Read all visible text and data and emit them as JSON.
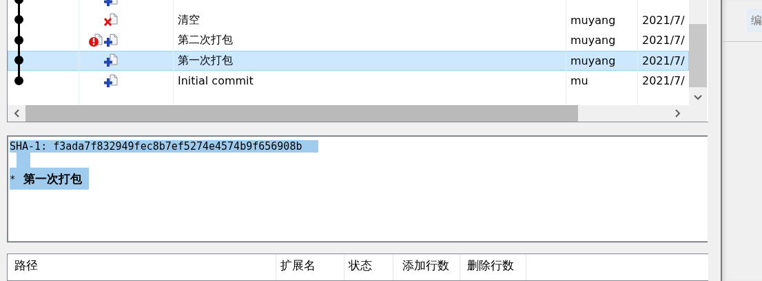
{
  "commits": [
    {
      "icons": [
        {
          "kind": "added"
        }
      ],
      "selected": false
    },
    {
      "icons": [
        {
          "kind": "deleted"
        }
      ],
      "message": "清空",
      "author": "muyang",
      "date": "2021/7/",
      "selected": false
    },
    {
      "icons": [
        {
          "kind": "warning"
        },
        {
          "kind": "added"
        }
      ],
      "message": "第二次打包",
      "author": "muyang",
      "date": "2021/7/",
      "selected": false
    },
    {
      "icons": [
        {
          "kind": "added"
        }
      ],
      "message": "第一次打包",
      "author": "muyang",
      "date": "2021/7/",
      "selected": true
    },
    {
      "icons": [
        {
          "kind": "added"
        }
      ],
      "message": "Initial commit",
      "author": "mu",
      "date": "2021/7/",
      "selected": false
    }
  ],
  "details": {
    "sha": "SHA-1: f3ada7f832949fec8b7ef5274e4574b9f656908b",
    "bullet": "*",
    "message": "第一次打包"
  },
  "files_table": {
    "columns": [
      "路径",
      "扩展名",
      "状态",
      "添加行数",
      "删除行数"
    ]
  },
  "side_button": {
    "label": "编"
  }
}
